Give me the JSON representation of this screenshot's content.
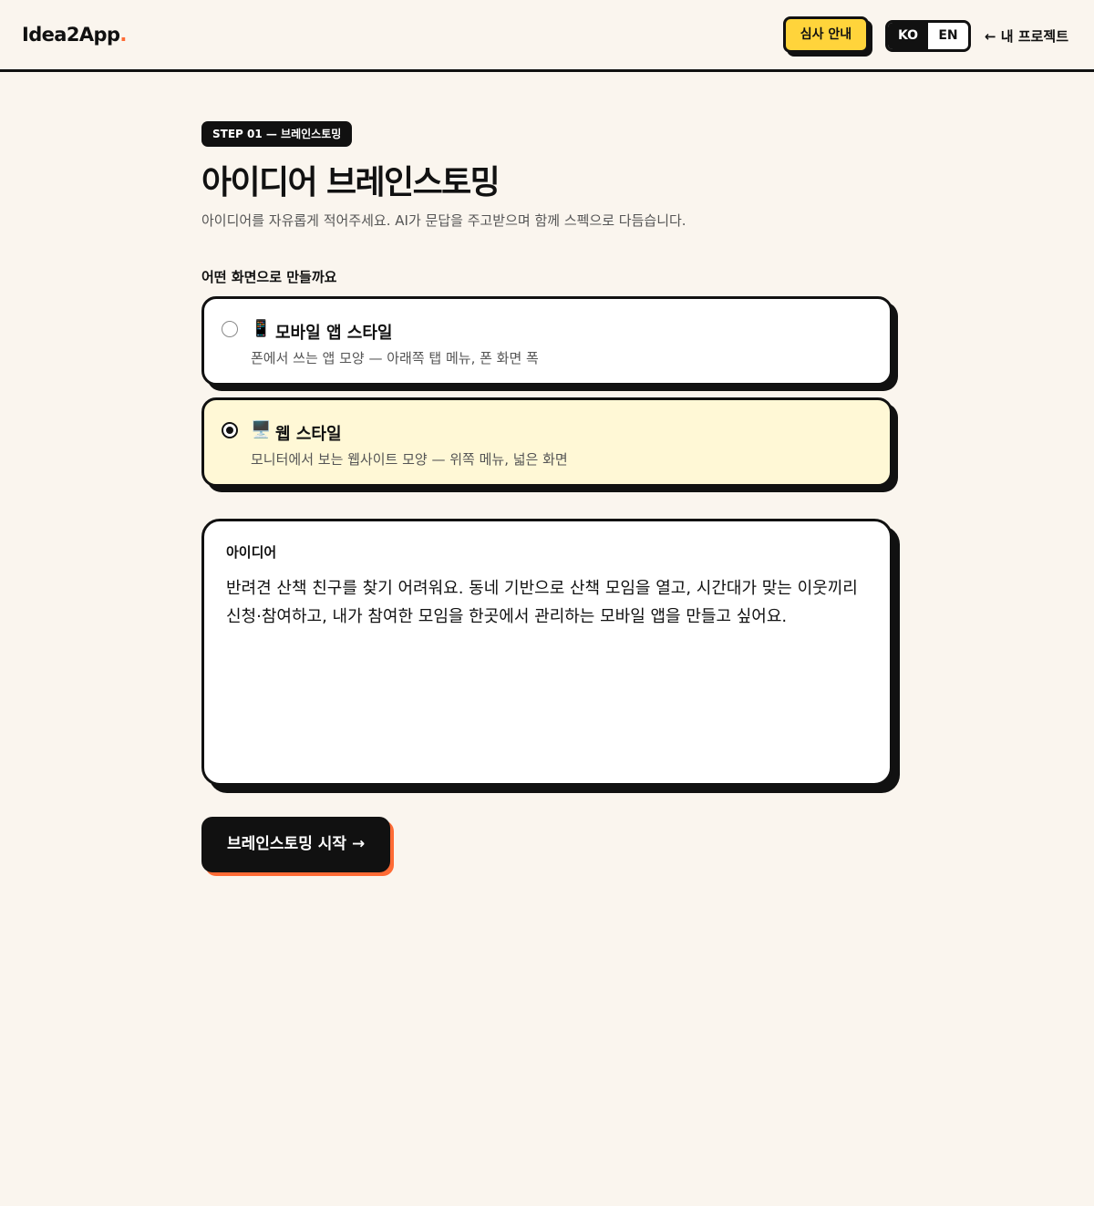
{
  "header": {
    "logo_text": "Idea2App",
    "logo_dot": ".",
    "guide_button": "심사 안내",
    "lang": {
      "ko": "KO",
      "en": "EN",
      "selected": "KO"
    },
    "back_link": "← 내 프로젝트"
  },
  "step": {
    "badge": "STEP 01 — 브레인스토밍",
    "title": "아이디어 브레인스토밍",
    "subtitle": "아이디어를 자유롭게 적어주세요. AI가 문답을 주고받으며 함께 스펙으로 다듬습니다."
  },
  "screen_type": {
    "label": "어떤 화면으로 만들까요",
    "selected": "web",
    "options": [
      {
        "id": "mobile",
        "icon": "📱",
        "icon_name": "mobile-phone-icon",
        "title": "모바일 앱 스타일",
        "description": "폰에서 쓰는 앱 모양 — 아래쪽 탭 메뉴, 폰 화면 폭"
      },
      {
        "id": "web",
        "icon": "🖥️",
        "icon_name": "desktop-monitor-icon",
        "title": "웹 스타일",
        "description": "모니터에서 보는 웹사이트 모양 — 위쪽 메뉴, 넓은 화면"
      }
    ]
  },
  "idea": {
    "label": "아이디어",
    "value": "반려견 산책 친구를 찾기 어려워요. 동네 기반으로 산책 모임을 열고, 시간대가 맞는 이웃끼리 신청·참여하고, 내가 참여한 모임을 한곳에서 관리하는 모바일 앱을 만들고 싶어요."
  },
  "actions": {
    "start_button": "브레인스토밍 시작 →"
  },
  "colors": {
    "background": "#faf5ee",
    "accent_yellow": "#ffd43b",
    "accent_orange": "#ff6b35",
    "selected_card": "#fff8d6",
    "ink": "#111111"
  }
}
